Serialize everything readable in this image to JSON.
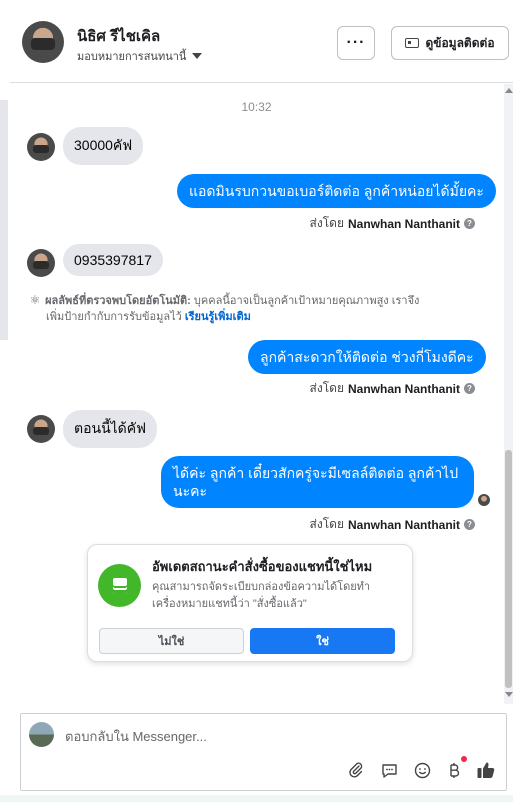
{
  "header": {
    "name": "นิธิศ รีไชเคิล",
    "assign": "มอบหมายการสนทนานี้",
    "more": "···",
    "contact_button": "ดูข้อมูลติดต่อ"
  },
  "conversation": {
    "time": "10:32",
    "messages": [
      {
        "dir": "in",
        "text": "30000คัฟ"
      },
      {
        "dir": "out",
        "text": "แอดมินรบกวนขอเบอร์ติดต่อ ลูกค้าหน่อยได้มั้ยคะ"
      },
      {
        "dir": "in",
        "text": "0935397817"
      },
      {
        "dir": "out",
        "text": "ลูกค้าสะดวกให้ติดต่อ ช่วงกี่โมงดีคะ"
      },
      {
        "dir": "in",
        "text": "ตอนนี้ได้คัฟ"
      },
      {
        "dir": "out",
        "line1": "ได้ค่ะ ลูกค้า เดี๋ยวสักครู่จะมีเซลล์ติดต่อ ลูกค้าไป",
        "line2": "นะคะ"
      }
    ],
    "sent_by_prefix": "ส่งโดย",
    "sent_by_name": "Nanwhan Nanthanit",
    "help": "?",
    "auto_detect": {
      "label": "ผลลัพธ์ที่ตรวจพบโดยอัตโนมัติ:",
      "text1": "บุคคลนี้อาจเป็นลูกค้าเป้าหมายคุณภาพสูง เราจึง",
      "text2": "เพิ่มป้ายกำกับการรับข้อมูลไว้",
      "link": "เรียนรู้เพิ่มเติม"
    }
  },
  "order_card": {
    "title": "อัพเดตสถานะคำสั่งซื้อของแชทนี้ใช่ไหม",
    "desc1": "คุณสามารถจัดระเบียบกล่องข้อความได้โดยทำ",
    "desc2": "เครื่องหมายแชทนี้ว่า \"สั่งซื้อแล้ว\"",
    "no": "ไม่ใช่",
    "yes": "ใช่"
  },
  "composer": {
    "placeholder": "ตอบกลับใน Messenger..."
  },
  "colors": {
    "accent": "#0084ff",
    "button_blue": "#1877f2",
    "order_icon": "#42b72a"
  }
}
